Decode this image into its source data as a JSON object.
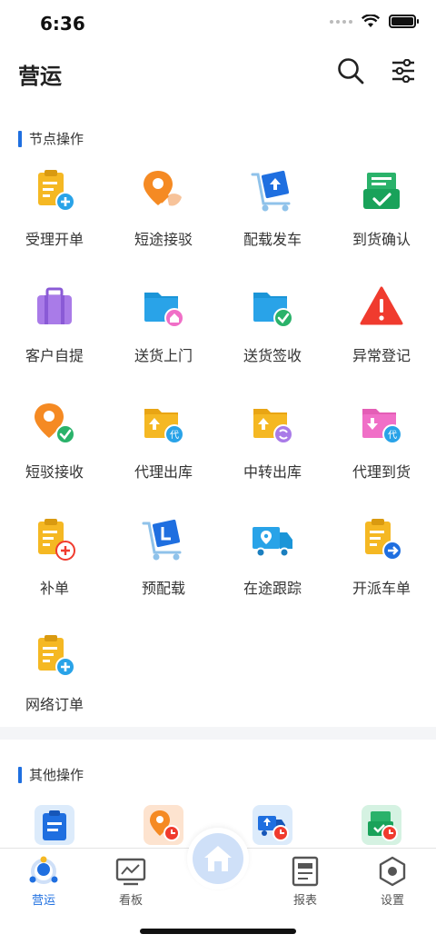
{
  "status_bar": {
    "time": "6:36"
  },
  "header": {
    "title": "营运",
    "search_icon": "search-icon",
    "filter_icon": "sliders-icon"
  },
  "sections": {
    "node_ops": {
      "title": "节点操作",
      "items": [
        {
          "label": "受理开单",
          "icon": "clipboard-plus-icon"
        },
        {
          "label": "短途接驳",
          "icon": "location-handoff-icon"
        },
        {
          "label": "配载发车",
          "icon": "cart-upload-icon"
        },
        {
          "label": "到货确认",
          "icon": "tray-check-icon"
        },
        {
          "label": "客户自提",
          "icon": "suitcase-icon"
        },
        {
          "label": "送货上门",
          "icon": "folder-home-icon"
        },
        {
          "label": "送货签收",
          "icon": "folder-check-icon"
        },
        {
          "label": "异常登记",
          "icon": "warning-icon"
        },
        {
          "label": "短驳接收",
          "icon": "location-check-icon"
        },
        {
          "label": "代理出库",
          "icon": "box-out-agent-icon"
        },
        {
          "label": "中转出库",
          "icon": "box-out-transfer-icon"
        },
        {
          "label": "代理到货",
          "icon": "box-in-agent-icon"
        },
        {
          "label": "补单",
          "icon": "clipboard-add-icon"
        },
        {
          "label": "预配载",
          "icon": "cart-l-icon"
        },
        {
          "label": "在途跟踪",
          "icon": "truck-location-icon"
        },
        {
          "label": "开派车单",
          "icon": "clipboard-arrow-icon"
        },
        {
          "label": "网络订单",
          "icon": "clipboard-plus-icon"
        }
      ]
    },
    "other_ops": {
      "title": "其他操作",
      "items": [
        {
          "icon": "clipboard-icon"
        },
        {
          "icon": "location-clock-icon"
        },
        {
          "icon": "truck-clock-icon"
        },
        {
          "icon": "tray-clock-icon"
        }
      ]
    }
  },
  "tabbar": {
    "tabs": [
      {
        "label": "营运",
        "icon": "operations-icon",
        "active": true
      },
      {
        "label": "看板",
        "icon": "monitor-icon",
        "active": false
      },
      {
        "label": "报表",
        "icon": "report-icon",
        "active": false
      },
      {
        "label": "设置",
        "icon": "settings-icon",
        "active": false
      }
    ],
    "home_icon": "home-icon"
  },
  "colors": {
    "accent": "#1f6fe0",
    "yellow": "#f5b823",
    "blue": "#29a3e8",
    "orange": "#f58a23",
    "green": "#2ab26a",
    "red": "#f03b2e",
    "purple": "#a97be8",
    "pink": "#f06fc7"
  }
}
